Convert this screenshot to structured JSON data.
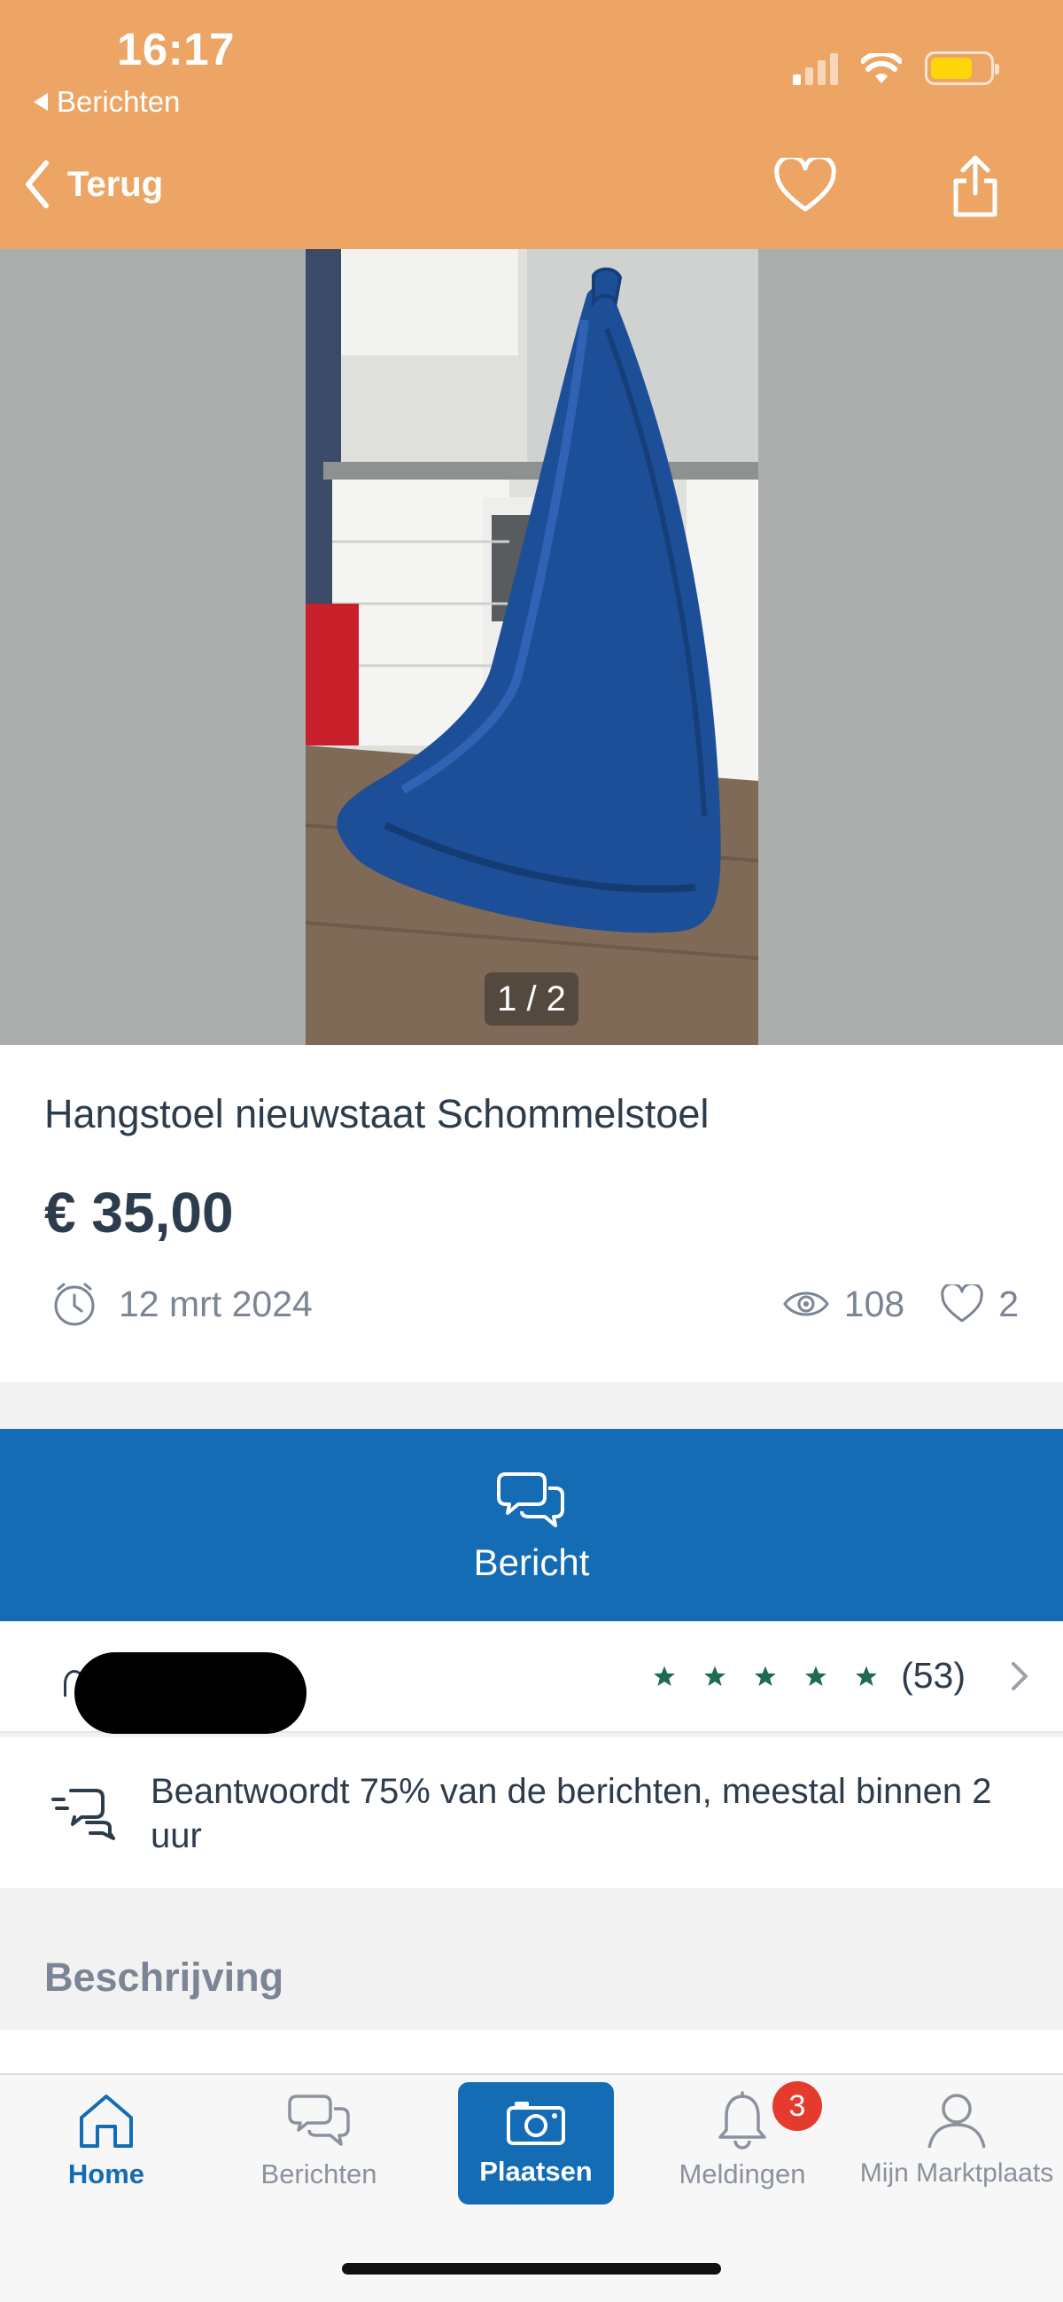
{
  "status_bar": {
    "time": "16:17",
    "back_app": "Berichten"
  },
  "nav": {
    "back_label": "Terug"
  },
  "gallery": {
    "counter": "1 / 2"
  },
  "listing": {
    "title": "Hangstoel nieuwstaat Schommelstoel",
    "price": "€ 35,00",
    "date": "12 mrt 2024",
    "views": "108",
    "favorites": "2"
  },
  "message_button": {
    "label": "Bericht"
  },
  "seller": {
    "rating_stars": 5,
    "review_count": "(53)"
  },
  "response": {
    "text": "Beantwoordt 75% van de berichten, meestal binnen 2 uur"
  },
  "description": {
    "heading": "Beschrijving"
  },
  "tabbar": {
    "home": "Home",
    "berichten": "Berichten",
    "plaatsen": "Plaatsen",
    "meldingen": "Meldingen",
    "meldingen_badge": "3",
    "mijn": "Mijn Marktplaats"
  },
  "colors": {
    "header": "#eda566",
    "primary_blue": "#136cb4",
    "star_green": "#1e6b4e",
    "badge_red": "#e53b2c"
  }
}
